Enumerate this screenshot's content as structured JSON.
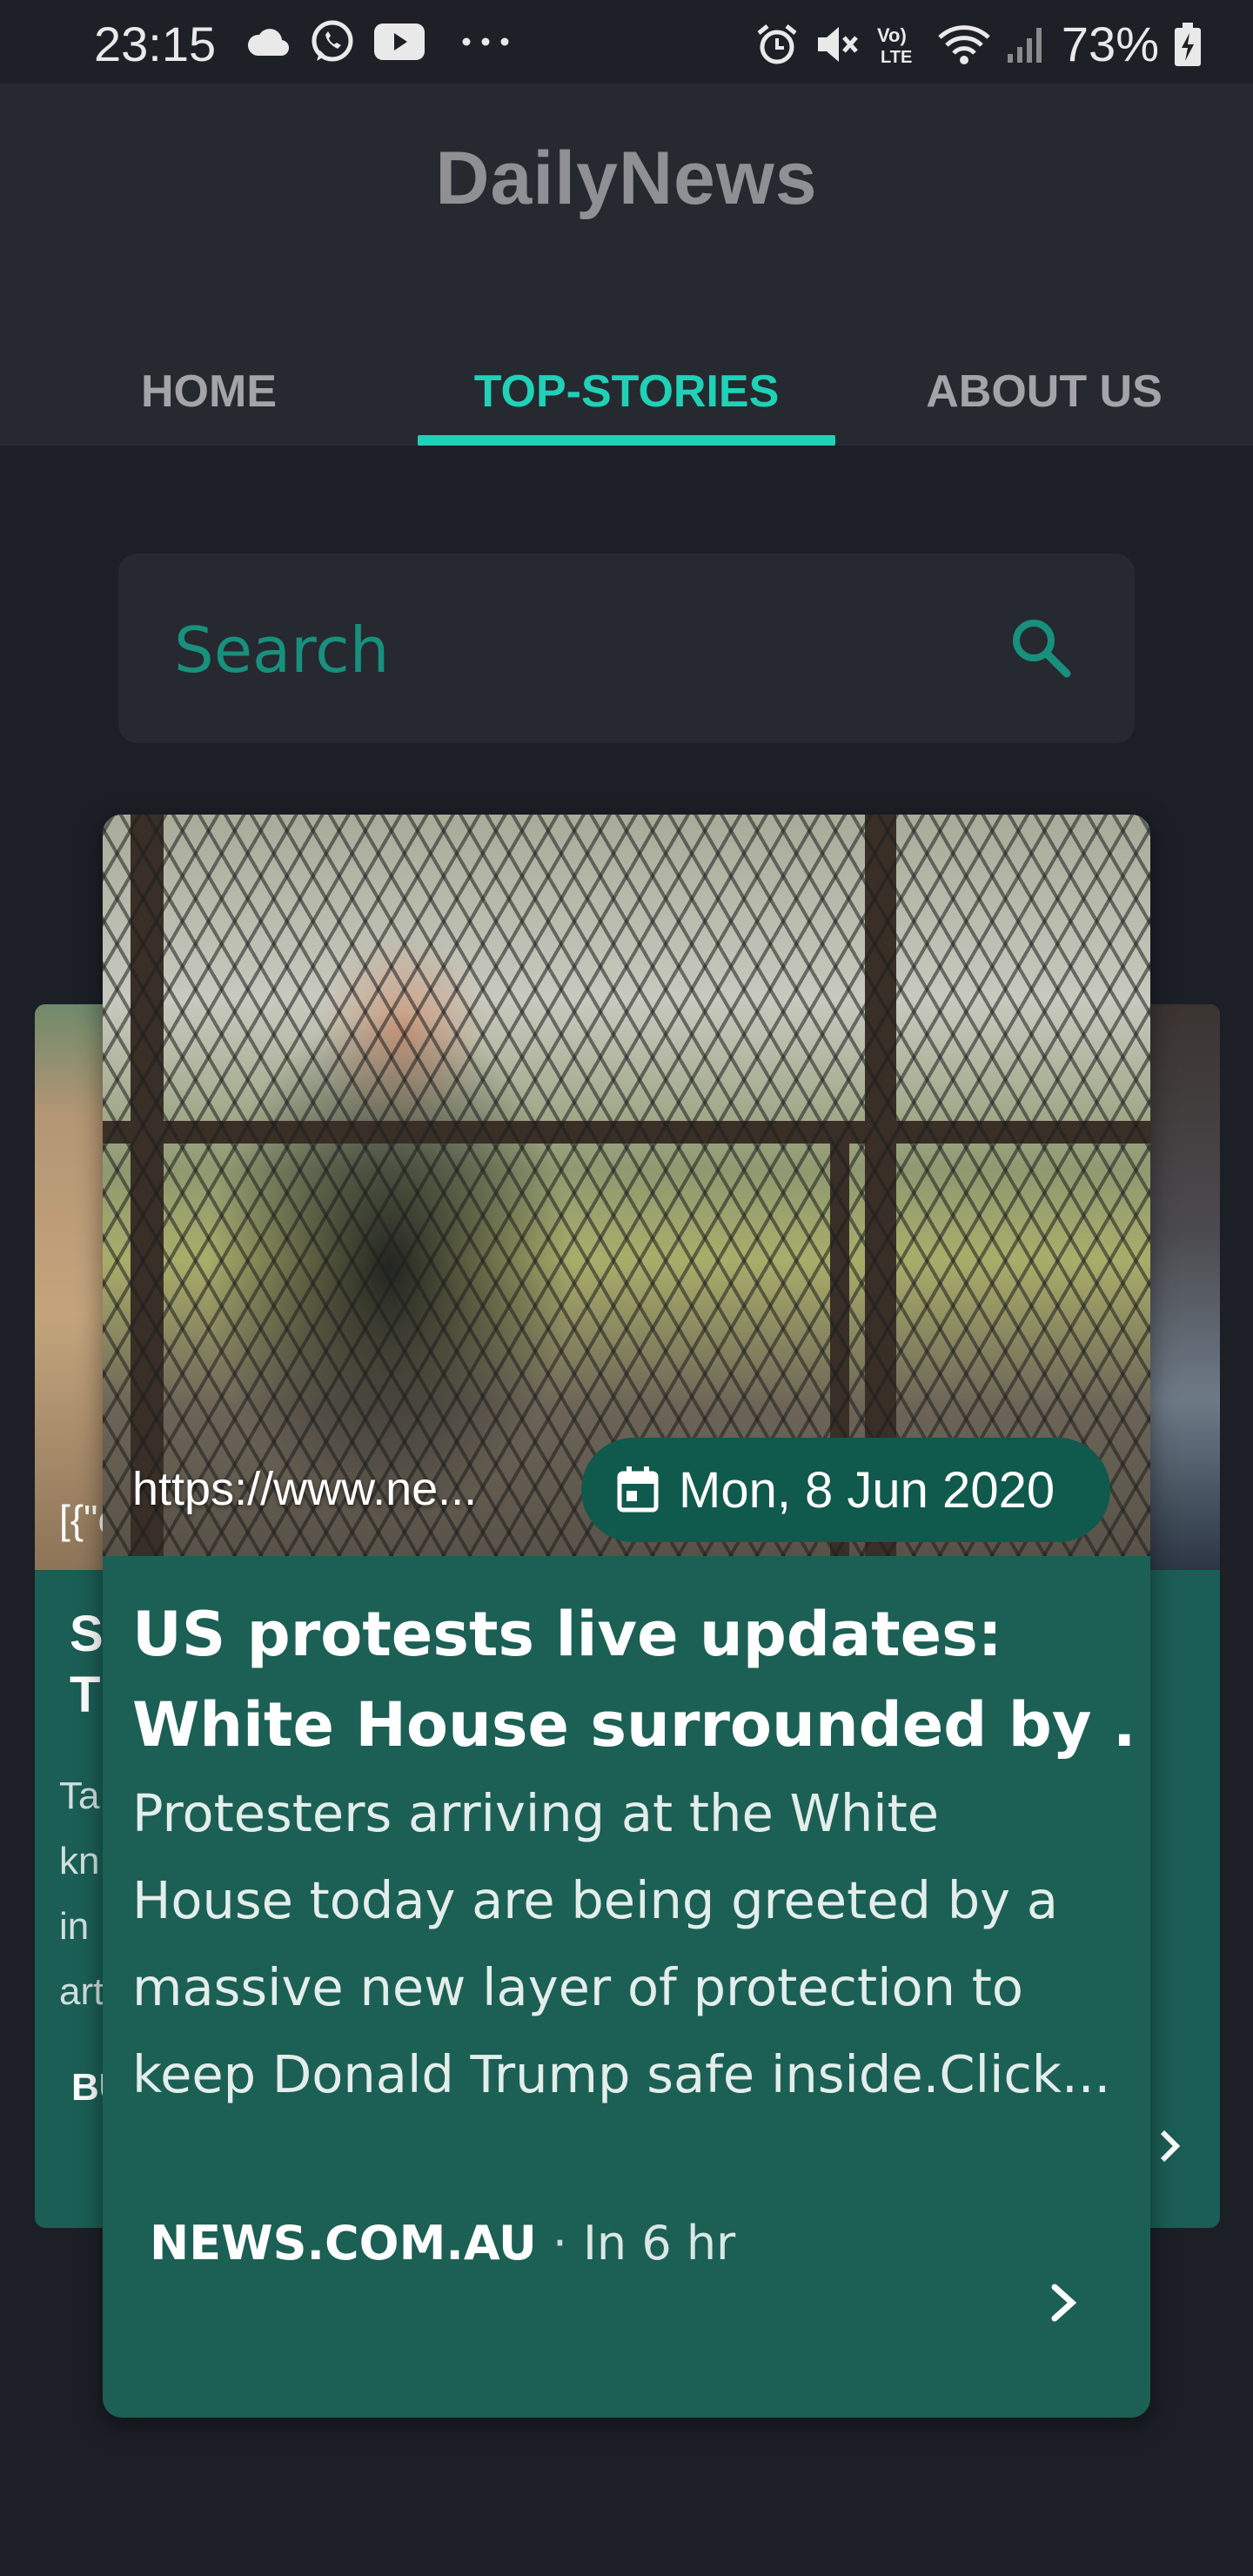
{
  "status_bar": {
    "time": "23:15",
    "icons_left": [
      "cloud-icon",
      "whatsapp-icon",
      "youtube-icon",
      "more-dots-icon"
    ],
    "icons_right": [
      "alarm-icon",
      "mute-icon",
      "volte-icon",
      "wifi-icon",
      "signal-icon"
    ],
    "battery_text": "73%"
  },
  "app": {
    "title": "DailyNews"
  },
  "tabs": [
    {
      "label": "HOME"
    },
    {
      "label": "TOP-STORIES"
    },
    {
      "label": "ABOUT US"
    }
  ],
  "search": {
    "placeholder": "Search"
  },
  "side_left": {
    "url_fragment": "[{\"c",
    "title_line1": "Sc",
    "title_line2": "Th",
    "desc_lines": [
      "Ta",
      "kn",
      "in",
      "art"
    ],
    "source": "BU"
  },
  "card": {
    "url": "https://www.ne...",
    "date": "Mon, 8 Jun 2020",
    "title_lines": [
      "US protests live updates:",
      "White House surrounded by ..."
    ],
    "description_lines": [
      "Protesters arriving at the White",
      "House today are being greeted by a",
      "massive new layer of protection to",
      "keep Donald Trump safe inside.Click..."
    ],
    "source": "NEWS.COM.AU",
    "separator": "·",
    "time": "In 6 hr"
  },
  "colors": {
    "accent": "#1fd1b6",
    "card": "#1b5f55",
    "background": "#1c1f26",
    "header": "#262930"
  }
}
